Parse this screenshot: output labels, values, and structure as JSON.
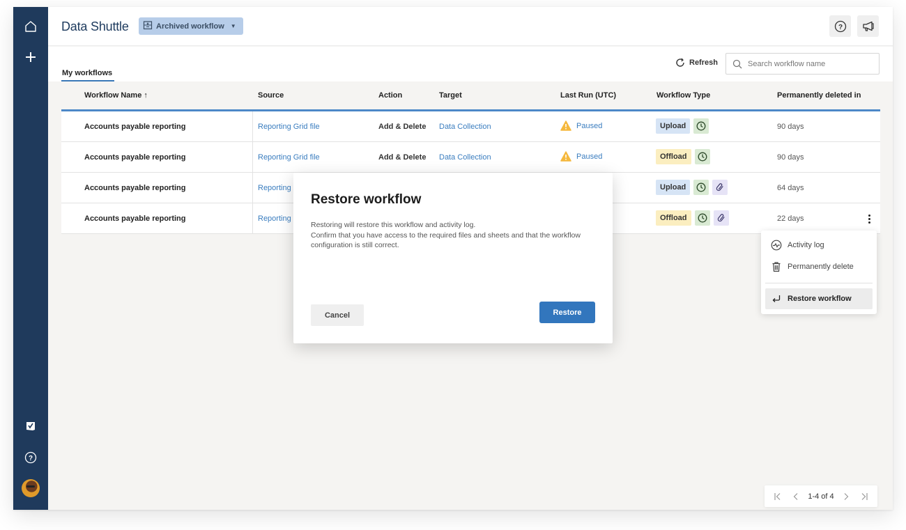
{
  "app": {
    "title": "Data Shuttle",
    "view_selector": "Archived workflow"
  },
  "sidebar": {
    "items": [
      {
        "icon": "home-icon"
      },
      {
        "icon": "plus-icon"
      },
      {
        "icon": "checklist-icon"
      },
      {
        "icon": "help-icon"
      },
      {
        "icon": "avatar"
      }
    ]
  },
  "header": {
    "help_icon": "help-icon",
    "announce_icon": "megaphone-icon"
  },
  "toolbar": {
    "tab_label": "My workflows",
    "refresh_label": "Refresh",
    "search_placeholder": "Search workflow name",
    "search_value": ""
  },
  "table": {
    "columns": [
      "Workflow Name ↑",
      "Source",
      "Action",
      "Target",
      "Last Run (UTC)",
      "Workflow Type",
      "Permanently deleted in"
    ],
    "rows": [
      {
        "name": "Accounts payable reporting",
        "source": "Reporting Grid file",
        "action": "Add & Delete",
        "target": "Data Collection",
        "last_run": "Paused",
        "type": "Upload",
        "scheduled": true,
        "linked": false,
        "deleted_in": "90 days"
      },
      {
        "name": "Accounts payable reporting",
        "source": "Reporting Grid file",
        "action": "Add & Delete",
        "target": "Data Collection",
        "last_run": "Paused",
        "type": "Offload",
        "scheduled": true,
        "linked": false,
        "deleted_in": "90 days"
      },
      {
        "name": "Accounts payable reporting",
        "source": "Reporting",
        "action": "",
        "target": "",
        "last_run": "",
        "type": "Upload",
        "scheduled": true,
        "linked": true,
        "deleted_in": "64 days"
      },
      {
        "name": "Accounts payable reporting",
        "source": "Reporting",
        "action": "",
        "target": "",
        "last_run": "",
        "type": "Offload",
        "scheduled": true,
        "linked": true,
        "deleted_in": "22 days"
      }
    ]
  },
  "context_menu": {
    "items": [
      {
        "label": "Activity log",
        "icon": "activity-icon"
      },
      {
        "label": "Permanently delete",
        "icon": "trash-icon"
      },
      {
        "label": "Restore workflow",
        "icon": "restore-icon",
        "active": true
      }
    ]
  },
  "modal": {
    "title": "Restore workflow",
    "body_line1": "Restoring will restore this workflow and activity log.",
    "body_line2": "Confirm that you have access to the required files and sheets and that the workflow configuration is still correct.",
    "cancel_label": "Cancel",
    "confirm_label": "Restore"
  },
  "pagination": {
    "label": "1-4 of 4"
  },
  "colors": {
    "sidebar": "#1f3a5c",
    "accent": "#3276bd",
    "link": "#3a7dbf",
    "upload_badge": "#d6e4f5",
    "offload_badge": "#fbeec0",
    "warning": "#f5b83d"
  }
}
